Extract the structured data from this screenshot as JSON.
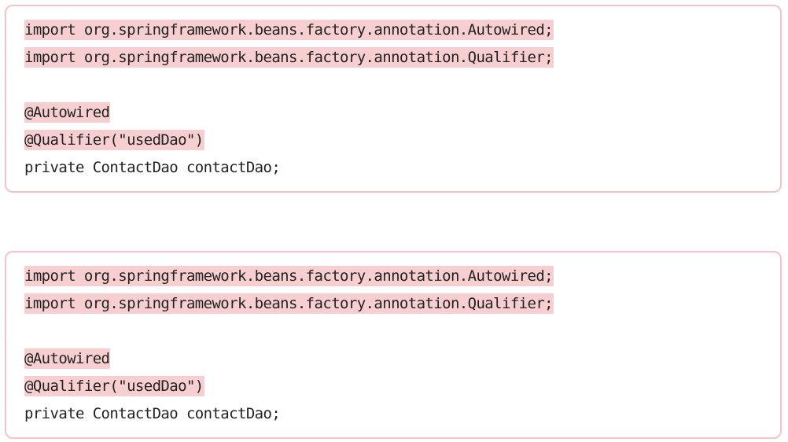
{
  "code_blocks": [
    {
      "lines": [
        {
          "text": "import org.springframework.beans.factory.annotation.Autowired;",
          "highlighted": true
        },
        {
          "text": "import org.springframework.beans.factory.annotation.Qualifier;",
          "highlighted": true
        },
        {
          "text": "",
          "highlighted": false
        },
        {
          "text": "@Autowired",
          "highlighted": true
        },
        {
          "text": "@Qualifier(\"usedDao\")",
          "highlighted": true
        },
        {
          "text": "private ContactDao contactDao;",
          "highlighted": false
        }
      ]
    },
    {
      "lines": [
        {
          "text": "import org.springframework.beans.factory.annotation.Autowired;",
          "highlighted": true
        },
        {
          "text": "import org.springframework.beans.factory.annotation.Qualifier;",
          "highlighted": true
        },
        {
          "text": "",
          "highlighted": false
        },
        {
          "text": "@Autowired",
          "highlighted": true
        },
        {
          "text": "@Qualifier(\"usedDao\")",
          "highlighted": true
        },
        {
          "text": "private ContactDao contactDao;",
          "highlighted": false
        }
      ]
    }
  ],
  "colors": {
    "border": "#f2c4c6",
    "highlight": "#f7cfd0",
    "text": "#222222"
  }
}
